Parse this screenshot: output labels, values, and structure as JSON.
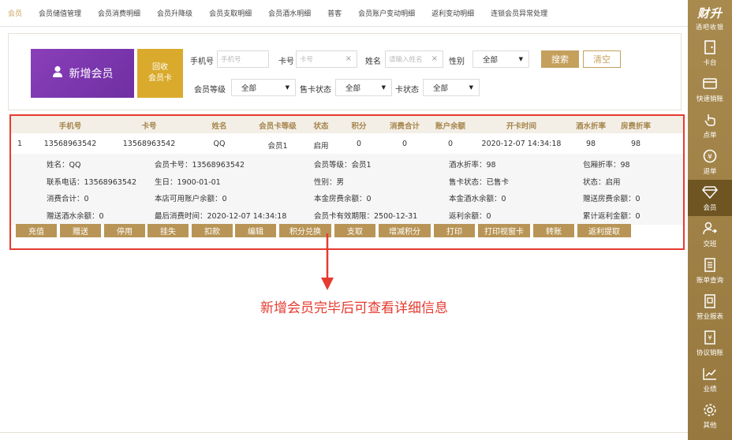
{
  "tabs": [
    "会员",
    "会员储值管理",
    "会员消费明细",
    "会员升降级",
    "会员支取明细",
    "会员酒水明细",
    "普客",
    "会员账户变动明细",
    "返利变动明细",
    "连锁会员异常处理"
  ],
  "sidebar": {
    "brand": "财升",
    "brand_sub": "酒吧收银",
    "items": [
      {
        "label": "卡台",
        "icon": "door-icon"
      },
      {
        "label": "快速销账",
        "icon": "card-icon"
      },
      {
        "label": "点单",
        "icon": "hand-pointer-icon"
      },
      {
        "label": "退单",
        "icon": "yen-return-icon"
      },
      {
        "label": "会员",
        "icon": "diamond-icon"
      },
      {
        "label": "交班",
        "icon": "handover-icon"
      },
      {
        "label": "账单查询",
        "icon": "bill-icon"
      },
      {
        "label": "营业报表",
        "icon": "report-icon"
      },
      {
        "label": "协议销账",
        "icon": "agreement-icon"
      },
      {
        "label": "业绩",
        "icon": "chart-line-icon"
      },
      {
        "label": "其他",
        "icon": "gear-icon"
      }
    ]
  },
  "search": {
    "new_member": "新增会员",
    "recycle_line1": "回收",
    "recycle_line2": "会员卡",
    "phone_label": "手机号",
    "phone_placeholder": "手机号",
    "card_label": "卡号",
    "card_placeholder": "卡号",
    "name_label": "姓名",
    "name_placeholder": "请输入姓名",
    "gender_label": "性别",
    "gender_value": "全部",
    "search_btn": "搜索",
    "clear_btn": "清空",
    "level_label": "会员等级",
    "level_value": "全部",
    "sale_label": "售卡状态",
    "sale_value": "全部",
    "card_status_label": "卡状态",
    "card_status_value": "全部"
  },
  "table": {
    "headers": [
      "手机号",
      "卡号",
      "姓名",
      "会员卡等级",
      "状态",
      "积分",
      "消费合计",
      "账户余额",
      "开卡时间",
      "酒水折率",
      "房费折率"
    ],
    "row": [
      "1",
      "13568963542",
      "13568963542",
      "QQ",
      "会员1",
      "启用",
      "0",
      "0",
      "0",
      "2020-12-07 14:34:18",
      "98",
      "98"
    ]
  },
  "detail": {
    "name": "姓名：QQ",
    "card_no": "会员卡号：13568963542",
    "level": "会员等级：会员1",
    "drink_discount": "酒水折率：98",
    "room_discount": "包厢折率：98",
    "phone": "联系电话：13568963542",
    "birthday": "生日：1900-01-01",
    "gender": "性别：男",
    "sale_status": "售卡状态：已售卡",
    "status": "状态：启用",
    "total_consume": "消费合计：0",
    "store_balance": "本店可用账户余额：0",
    "room_balance": "本金房费余额：0",
    "drink_balance": "本金酒水余额：0",
    "gift_room": "赠送房费余额：0",
    "gift_drink": "赠送酒水余额：0",
    "last_consume": "最后消费时间：2020-12-07 14:34:18",
    "expire": "会员卡有效期限：2500-12-31",
    "rebate": "返利余额：0",
    "total_rebate": "累计返利金额：0"
  },
  "actions": [
    "充值",
    "赠送",
    "停用",
    "挂失",
    "扣款",
    "编辑",
    "积分兑换",
    "支取",
    "增减积分",
    "打印",
    "打印视窗卡",
    "转账",
    "返利提取"
  ],
  "annotation": "新增会员完毕后可查看详细信息",
  "colors": {
    "accent": "#c4a05c",
    "sidebar": "#a88a4f",
    "highlight": "#e53b30",
    "purple": "#7a36ad",
    "gold_btn": "#d9aa2c"
  }
}
